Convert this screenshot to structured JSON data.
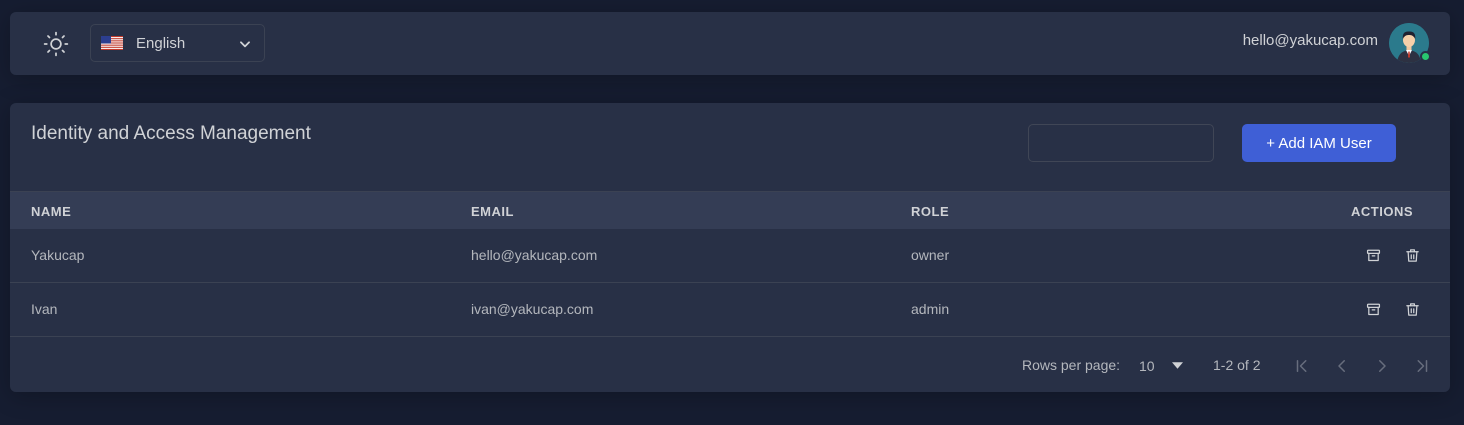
{
  "header": {
    "language": {
      "label": "English",
      "flag": "us-flag-icon"
    },
    "user": {
      "email": "hello@yakucap.com",
      "status": "online"
    },
    "icons": {
      "theme": "sun-icon",
      "chevron": "chevron-down-icon"
    }
  },
  "iam": {
    "title": "Identity and Access Management",
    "search": {
      "value": "",
      "placeholder": ""
    },
    "add_button_label": "+ Add IAM User",
    "columns": [
      "NAME",
      "EMAIL",
      "ROLE",
      "ACTIONS"
    ],
    "rows": [
      {
        "name": "Yakucap",
        "email": "hello@yakucap.com",
        "role": "owner"
      },
      {
        "name": "Ivan",
        "email": "ivan@yakucap.com",
        "role": "admin"
      }
    ],
    "row_actions": [
      "archive-icon",
      "trash-icon"
    ],
    "pagination": {
      "rows_per_page_label": "Rows per page:",
      "rows_per_page": "10",
      "range": "1-2 of 2"
    }
  },
  "colors": {
    "background": "#161d31",
    "card": "#283046",
    "table_header": "#343d55",
    "primary_button": "#3f5fd6",
    "online": "#28c76f"
  }
}
